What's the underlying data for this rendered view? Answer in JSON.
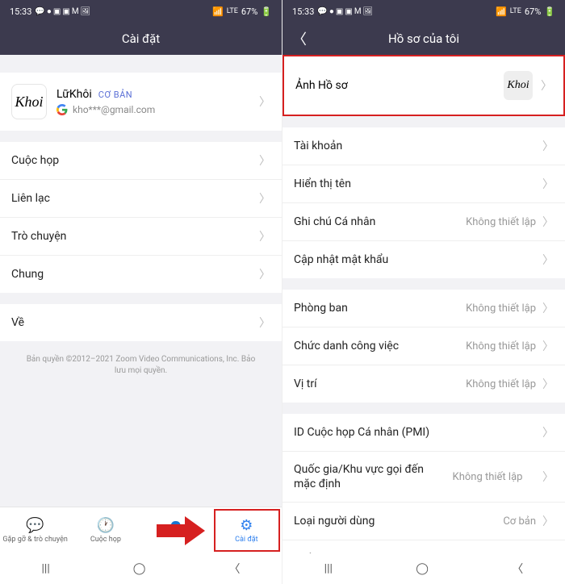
{
  "status": {
    "time": "15:33",
    "battery": "67%"
  },
  "left": {
    "title": "Cài đặt",
    "profile": {
      "name": "LữKhôi",
      "badge": "CƠ BẢN",
      "email": "kho***@gmail.com",
      "avatar": "Khoi"
    },
    "menu1": [
      "Cuộc họp",
      "Liên lạc",
      "Trò chuyện",
      "Chung"
    ],
    "menu2": [
      "Về"
    ],
    "copyright": "Bản quyền ©2012–2021 Zoom Video Communications, Inc. Bảo lưu mọi quyền.",
    "tabs": [
      {
        "label": "Gặp gỡ & trò chuyện"
      },
      {
        "label": "Cuộc họp"
      },
      {
        "label": ""
      },
      {
        "label": "Cài đặt"
      }
    ]
  },
  "right": {
    "title": "Hồ sơ của tôi",
    "photoRow": {
      "label": "Ảnh Hồ sơ",
      "avatar": "Khoi"
    },
    "group1": [
      {
        "label": "Tài khoản",
        "value": ""
      },
      {
        "label": "Hiển thị tên",
        "value": ""
      },
      {
        "label": "Ghi chú Cá nhân",
        "value": "Không thiết lập"
      },
      {
        "label": "Cập nhật mật khẩu",
        "value": ""
      }
    ],
    "group2": [
      {
        "label": "Phòng ban",
        "value": "Không thiết lập"
      },
      {
        "label": "Chức danh công việc",
        "value": "Không thiết lập"
      },
      {
        "label": "Vị trí",
        "value": "Không thiết lập"
      }
    ],
    "group3": [
      {
        "label": "ID Cuộc họp Cá nhân (PMI)",
        "value": ""
      },
      {
        "label": "Quốc gia/Khu vực gọi đến mặc định",
        "value": "Không thiết lập"
      },
      {
        "label": "Loại người dùng",
        "value": "Cơ bản"
      },
      {
        "label": "Giấy phép",
        "value": ""
      }
    ]
  }
}
